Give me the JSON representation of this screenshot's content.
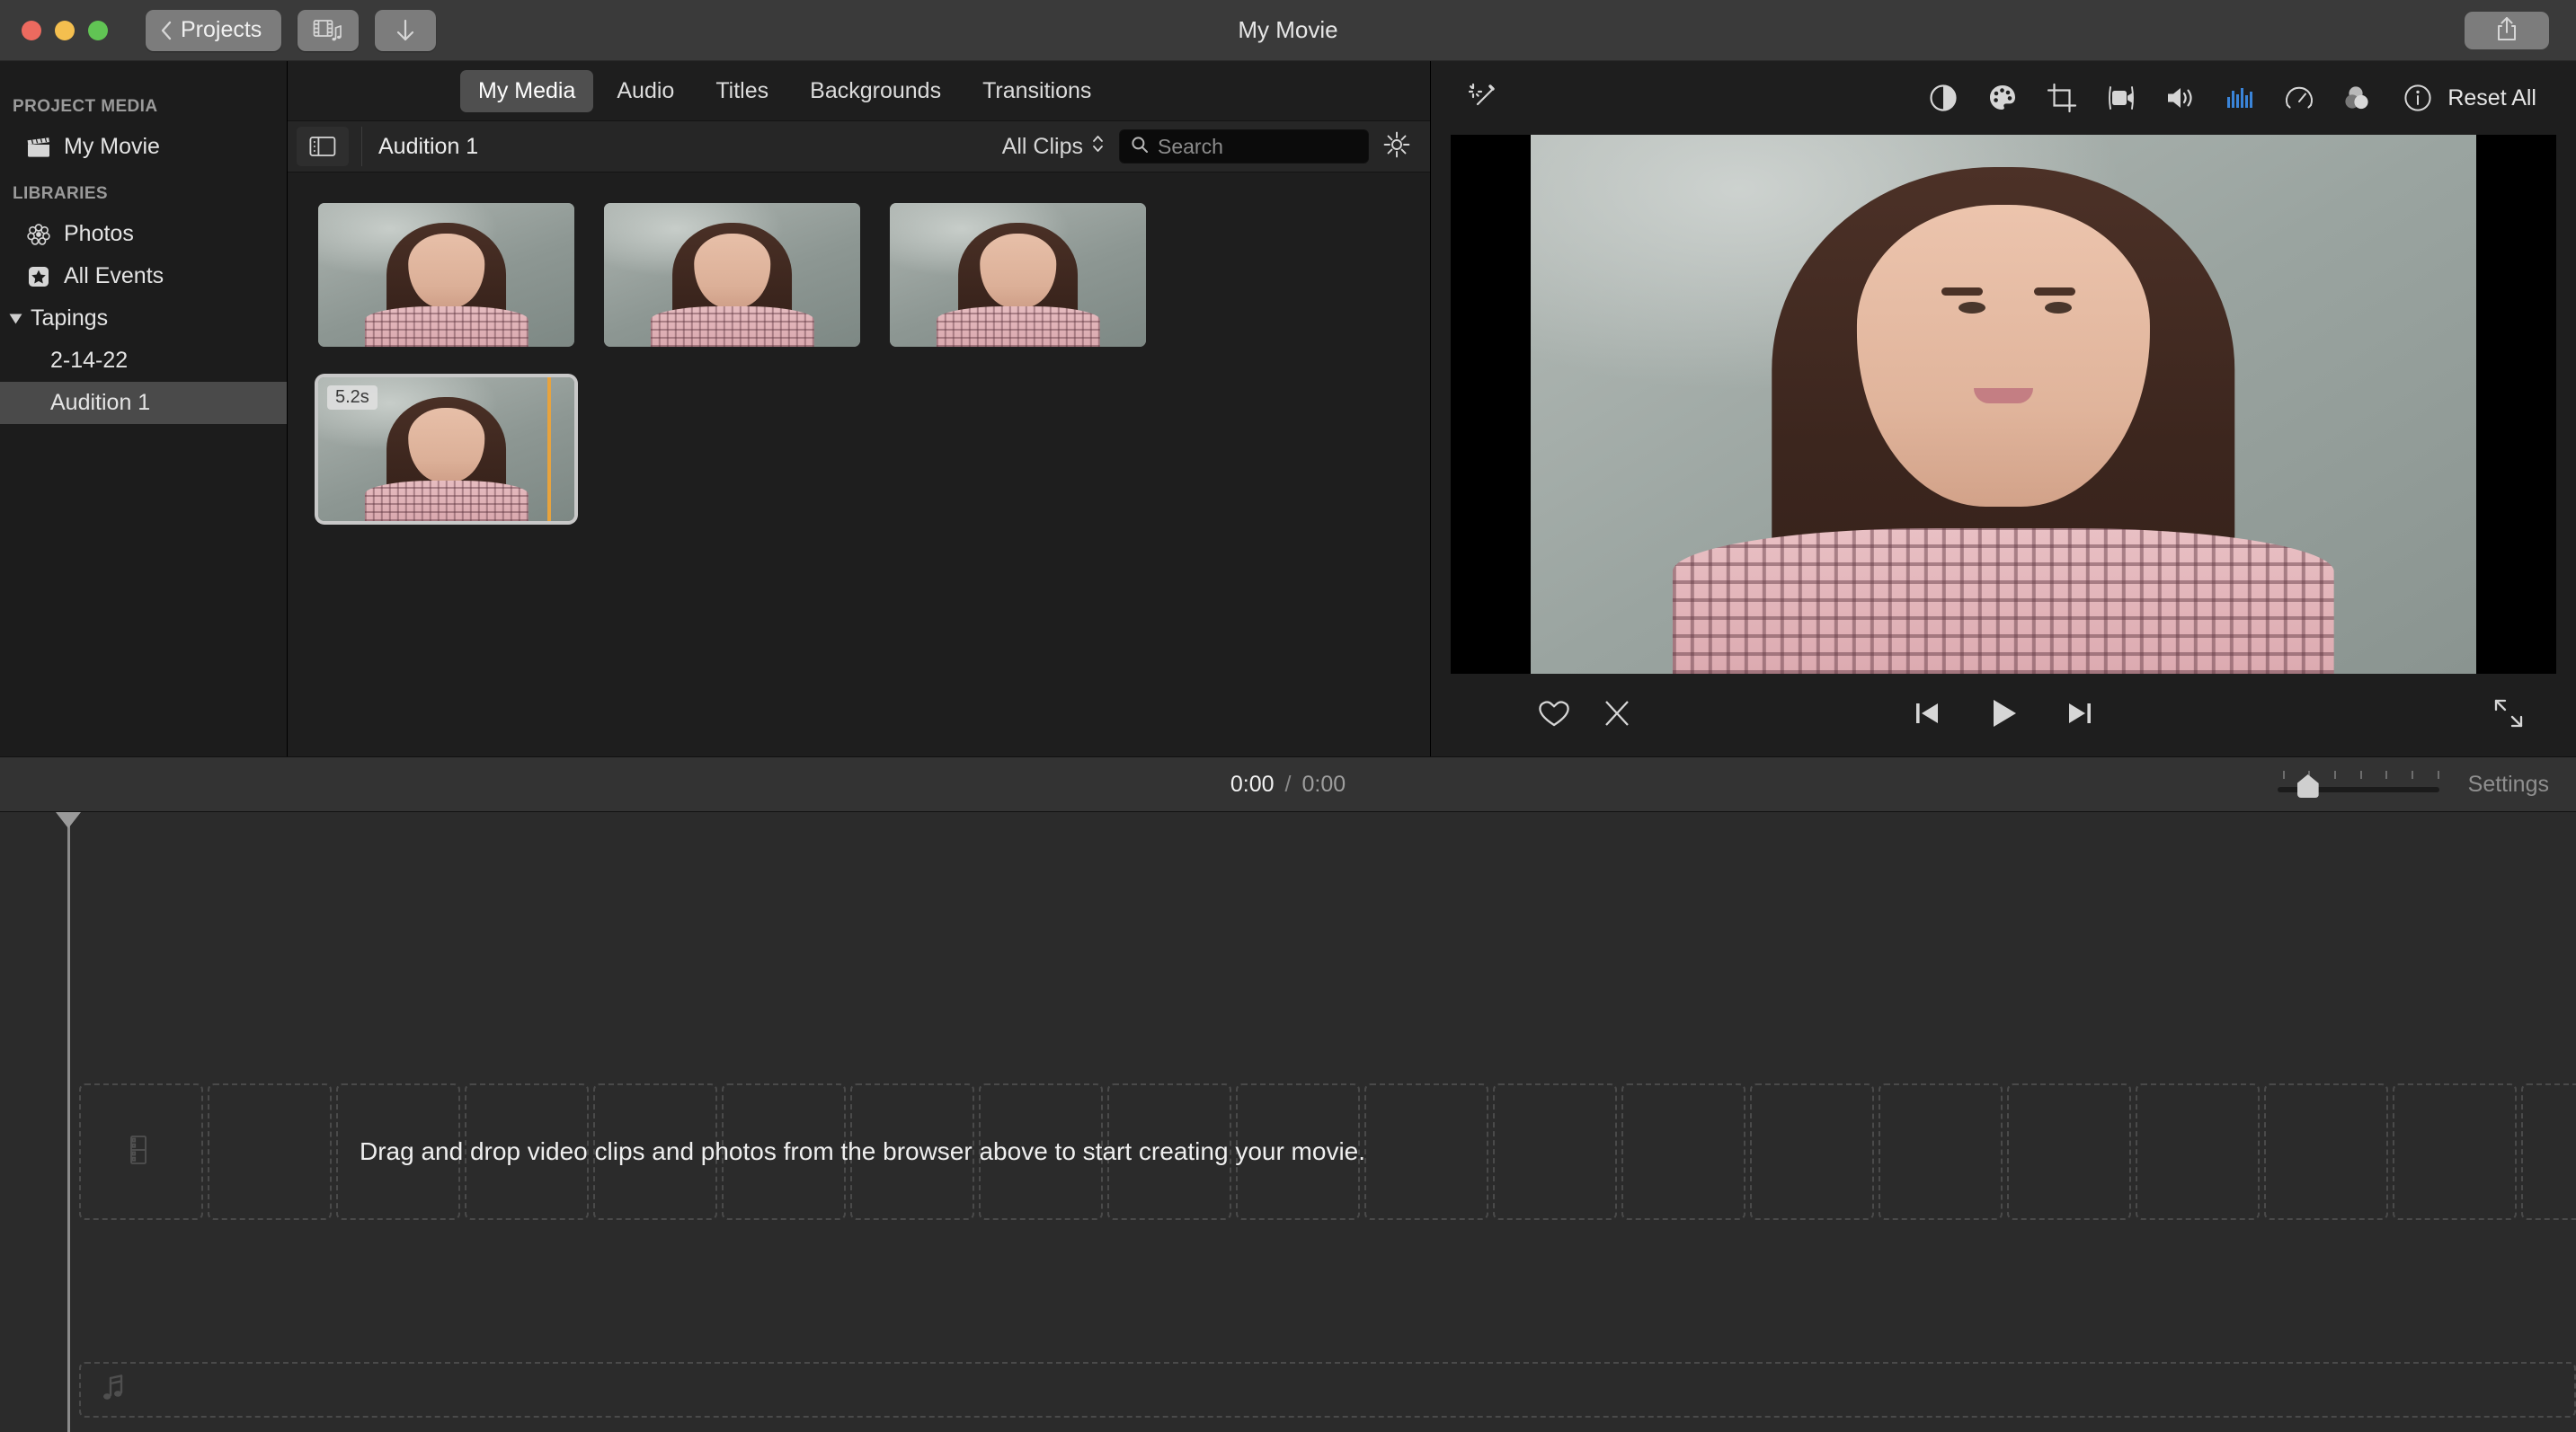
{
  "window": {
    "title": "My Movie",
    "back_label": "Projects",
    "media_button_icon": "film-music-icon",
    "import_button_icon": "download-arrow-icon",
    "share_button_icon": "share-icon"
  },
  "sidebar": {
    "sections": [
      {
        "header": "PROJECT MEDIA",
        "items": [
          {
            "label": "My Movie",
            "icon": "clapperboard-icon",
            "selected": false
          }
        ]
      },
      {
        "header": "LIBRARIES",
        "items": [
          {
            "label": "Photos",
            "icon": "photos-flower-icon",
            "selected": false
          },
          {
            "label": "All Events",
            "icon": "star-icon",
            "selected": false
          }
        ]
      }
    ],
    "group": {
      "label": "Tapings",
      "expanded": true,
      "children": [
        {
          "label": "2-14-22",
          "selected": false
        },
        {
          "label": "Audition 1",
          "selected": true
        }
      ]
    }
  },
  "browser": {
    "tabs": [
      {
        "label": "My Media",
        "active": true
      },
      {
        "label": "Audio",
        "active": false
      },
      {
        "label": "Titles",
        "active": false
      },
      {
        "label": "Backgrounds",
        "active": false
      },
      {
        "label": "Transitions",
        "active": false
      }
    ],
    "title": "Audition 1",
    "filter": "All Clips",
    "search": {
      "value": "",
      "placeholder": "Search"
    },
    "settings_icon": "gear-icon",
    "panel_toggle_icon": "sidebar-toggle-icon",
    "clips": [
      {
        "duration": "",
        "selected": false
      },
      {
        "duration": "",
        "selected": false
      },
      {
        "duration": "",
        "selected": false
      },
      {
        "duration": "5.2s",
        "selected": true
      }
    ]
  },
  "viewer": {
    "tools": [
      {
        "name": "enhance-wand-icon",
        "active": false
      },
      {
        "name": "color-balance-icon",
        "active": false
      },
      {
        "name": "color-correction-icon",
        "active": false
      },
      {
        "name": "crop-icon",
        "active": false
      },
      {
        "name": "stabilization-icon",
        "active": false
      },
      {
        "name": "volume-icon",
        "active": false
      },
      {
        "name": "noise-equalizer-icon",
        "active": true
      },
      {
        "name": "speed-icon",
        "active": false
      },
      {
        "name": "filters-icon",
        "active": false
      },
      {
        "name": "info-icon",
        "active": false
      }
    ],
    "reset_label": "Reset All",
    "controls": {
      "favorite_icon": "heart-icon",
      "reject_icon": "x-reject-icon",
      "previous_icon": "skip-previous-icon",
      "play_icon": "play-icon",
      "next_icon": "skip-next-icon",
      "fullscreen_icon": "fullscreen-icon"
    }
  },
  "timeline": {
    "current_time": "0:00",
    "separator": "/",
    "total_time": "0:00",
    "settings_label": "Settings",
    "zoom_value": 14,
    "drop_hint": "Drag and drop video clips and photos from the browser above to start creating your movie.",
    "video_slot_icon": "film-strip-icon",
    "audio_slot_icon": "music-note-icon",
    "colors": {
      "accent": "#3a84d8",
      "playhead": "#8a8a8a",
      "badge": "#e8a33d"
    }
  }
}
